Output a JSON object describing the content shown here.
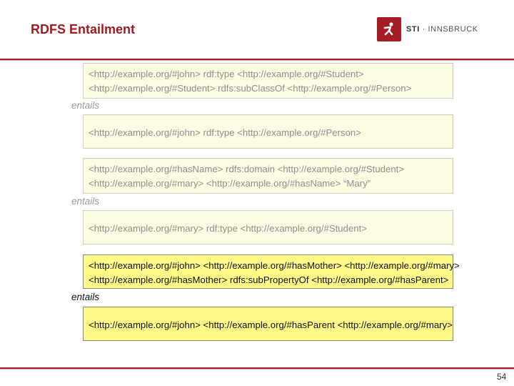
{
  "title": "RDFS Entailment",
  "logo": {
    "brand": "STI",
    "separator": " · ",
    "org": "INNSBRUCK"
  },
  "colors": {
    "accent": "#a11a1f",
    "highlight": "#fff98a",
    "faded_box": "#fdfbe2"
  },
  "blocks": [
    {
      "lines": [
        "<http://example.org/#john> rdf:type <http://example.org/#Student>",
        "<http://example.org/#Student> rdfs:subClassOf <http://example.org/#Person>"
      ]
    },
    {
      "entails": "entails"
    },
    {
      "lines": [
        "<http://example.org/#john> rdf:type <http://example.org/#Person>"
      ]
    },
    {
      "lines": [
        "<http://example.org/#hasName> rdfs:domain <http://example.org/#Student>",
        "<http://example.org/#mary> <http://example.org/#hasName> “Mary”"
      ]
    },
    {
      "entails": "entails"
    },
    {
      "lines": [
        "<http://example.org/#mary> rdf:type <http://example.org/#Student>"
      ]
    },
    {
      "lines": [
        "<http://example.org/#john> <http://example.org/#hasMother> <http://example.org/#mary>",
        "<http://example.org/#hasMother> rdfs:subPropertyOf <http://example.org/#hasParent>"
      ]
    },
    {
      "entails": "entails"
    },
    {
      "lines": [
        "<http://example.org/#john> <http://example.org/#hasParent <http://example.org/#mary>"
      ]
    }
  ],
  "page_number": "54"
}
